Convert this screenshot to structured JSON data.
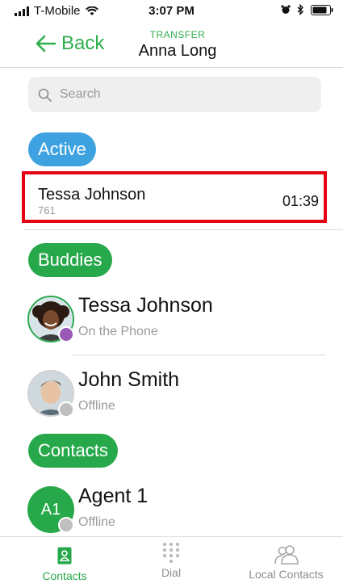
{
  "status_bar": {
    "carrier": "T-Mobile",
    "time": "3:07 PM"
  },
  "header": {
    "back_label": "Back",
    "subtitle": "TRANSFER",
    "title": "Anna Long"
  },
  "search": {
    "placeholder": "Search"
  },
  "sections": {
    "active": "Active",
    "buddies": "Buddies",
    "contacts": "Contacts"
  },
  "active_call": {
    "name": "Tessa Johnson",
    "number": "761",
    "duration": "01:39"
  },
  "buddies": [
    {
      "name": "Tessa Johnson",
      "status": "On the Phone",
      "badge_color": "#9b59b6"
    },
    {
      "name": "John Smith",
      "status": "Offline",
      "badge_color": "#bfbfbf"
    }
  ],
  "contacts": [
    {
      "initials": "A1",
      "name": "Agent 1",
      "status": "Offline",
      "badge_color": "#bfbfbf"
    }
  ],
  "tabs": [
    {
      "label": "Contacts",
      "active": true
    },
    {
      "label": "Dial",
      "active": false
    },
    {
      "label": "Local Contacts",
      "active": false
    }
  ],
  "colors": {
    "accent": "#2fae4e",
    "active_pill": "#3ea2e0",
    "highlight": "#e50012"
  }
}
